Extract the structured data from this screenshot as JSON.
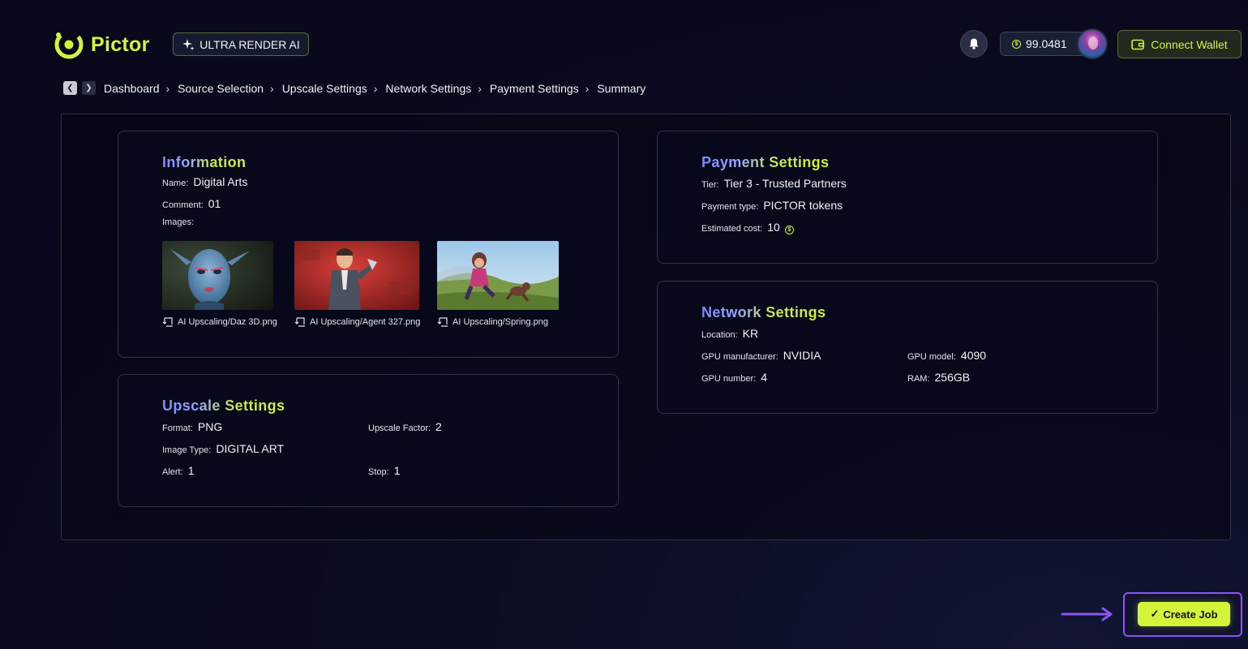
{
  "brand": {
    "name": "Pictor",
    "badge": "ULTRA RENDER AI",
    "accent": "#d4f43a"
  },
  "header": {
    "balance": "99.0481",
    "connect_wallet": "Connect Wallet"
  },
  "breadcrumb": [
    "Dashboard",
    "Source Selection",
    "Upscale Settings",
    "Network Settings",
    "Payment Settings",
    "Summary"
  ],
  "information": {
    "title": "Information",
    "name_label": "Name:",
    "name_value": "Digital Arts",
    "comment_label": "Comment:",
    "comment_value": "01",
    "images_label": "Images:",
    "images": [
      {
        "caption": "AI Upscaling/Daz 3D.png"
      },
      {
        "caption": "AI Upscaling/Agent 327.png"
      },
      {
        "caption": "AI Upscaling/Spring.png"
      }
    ]
  },
  "upscale": {
    "title": "Upscale Settings",
    "format_label": "Format:",
    "format_value": "PNG",
    "factor_label": "Upscale Factor:",
    "factor_value": "2",
    "image_type_label": "Image Type:",
    "image_type_value": "DIGITAL ART",
    "alert_label": "Alert:",
    "alert_value": "1",
    "stop_label": "Stop:",
    "stop_value": "1"
  },
  "payment": {
    "title": "Payment Settings",
    "tier_label": "Tier:",
    "tier_value": "Tier 3 - Trusted Partners",
    "type_label": "Payment type:",
    "type_value": "PICTOR tokens",
    "cost_label": "Estimated cost:",
    "cost_value": "10"
  },
  "network": {
    "title": "Network Settings",
    "location_label": "Location:",
    "location_value": "KR",
    "gpu_manufacturer_label": "GPU manufacturer:",
    "gpu_manufacturer_value": "NVIDIA",
    "gpu_model_label": "GPU model:",
    "gpu_model_value": "4090",
    "gpu_number_label": "GPU number:",
    "gpu_number_value": "4",
    "ram_label": "RAM:",
    "ram_value": "256GB"
  },
  "actions": {
    "create_job": "Create Job"
  }
}
